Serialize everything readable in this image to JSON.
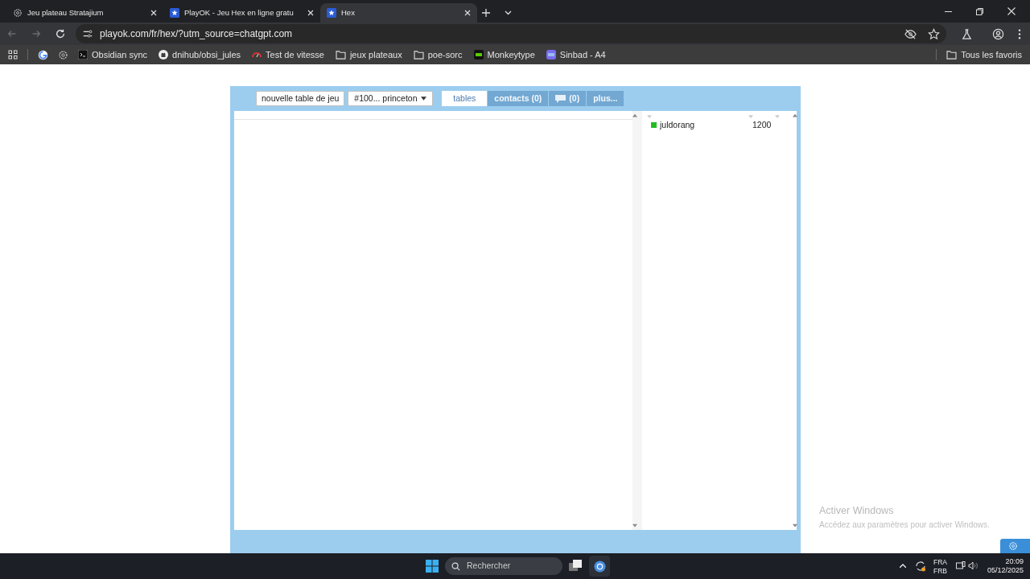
{
  "browser_tabs": [
    {
      "title": "Jeu plateau Stratajium",
      "kind": "gear",
      "selected": false
    },
    {
      "title": "PlayOK - Jeu Hex en ligne gratu",
      "kind": "star",
      "selected": false
    },
    {
      "title": "Hex",
      "kind": "star",
      "selected": true
    }
  ],
  "address_bar": {
    "url": "playok.com/fr/hex/?utm_source=chatgpt.com"
  },
  "bookmarks": [
    {
      "label": "Obsidian sync",
      "kind": "terminal"
    },
    {
      "label": "dnihub/obsi_jules",
      "kind": "github"
    },
    {
      "label": "Test de vitesse",
      "kind": "gauge"
    },
    {
      "label": "jeux plateaux",
      "kind": "folder"
    },
    {
      "label": "poe-sorc",
      "kind": "folder"
    },
    {
      "label": "Monkeytype",
      "kind": "mt"
    },
    {
      "label": "Sinbad - A4",
      "kind": "app"
    }
  ],
  "all_bookmarks": "Tous les favoris",
  "game": {
    "new_table_button": "nouvelle table de jeu",
    "room_select": "#100... princeton",
    "tabs": [
      {
        "label": "tables",
        "kind": "text",
        "selected": true
      },
      {
        "label": "contacts (0)",
        "kind": "text",
        "selected": false
      },
      {
        "label": "(0)",
        "kind": "chat",
        "selected": false
      },
      {
        "label": "plus...",
        "kind": "text",
        "selected": false
      }
    ],
    "players": [
      {
        "name": "juldorang",
        "rating": "1200",
        "color": "#22bb22"
      }
    ]
  },
  "activation": {
    "title": "Activer Windows",
    "message": "Accédez aux paramètres pour activer Windows."
  },
  "taskbar": {
    "search_placeholder": "Rechercher",
    "lang_top": "FRA",
    "lang_bottom": "FRB",
    "time": "20:09",
    "date": "05/12/2025"
  }
}
